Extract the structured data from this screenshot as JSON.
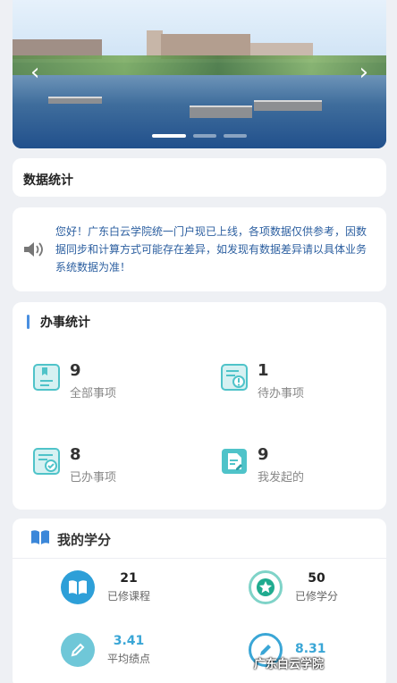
{
  "banner": {
    "active_index": 0,
    "slide_count": 3,
    "prev_icon": "chevron-left-icon",
    "next_icon": "chevron-right-icon"
  },
  "stats_section": {
    "title": "数据统计"
  },
  "notice": {
    "icon": "speaker-icon",
    "text": "您好！广东白云学院统一门户现已上线，各项数据仅供参考，因数据同步和计算方式可能存在差异，如发现有数据差异请以具体业务系统数据为准！"
  },
  "affairs": {
    "title": "办事统计",
    "items": [
      {
        "value": "9",
        "label": "全部事项",
        "icon": "document-all-icon"
      },
      {
        "value": "1",
        "label": "待办事项",
        "icon": "document-pending-icon"
      },
      {
        "value": "8",
        "label": "已办事项",
        "icon": "document-done-icon"
      },
      {
        "value": "9",
        "label": "我发起的",
        "icon": "document-initiated-icon"
      }
    ]
  },
  "credits": {
    "title": "我的学分",
    "title_icon": "book-icon",
    "items": [
      {
        "value": "21",
        "label": "已修课程",
        "icon": "book-icon"
      },
      {
        "value": "50",
        "label": "已修学分",
        "icon": "star-icon"
      },
      {
        "value": "3.41",
        "label": "平均绩点",
        "icon": "pencil-icon"
      },
      {
        "value": "8.31",
        "label": "",
        "icon": "pencil-icon"
      }
    ]
  },
  "watermark": "广东白云学院",
  "colors": {
    "accent": "#4a8fe0",
    "teal": "#4fc3c9",
    "notice_text": "#2c5fa0",
    "gpa_value": "#3aa6d6"
  }
}
